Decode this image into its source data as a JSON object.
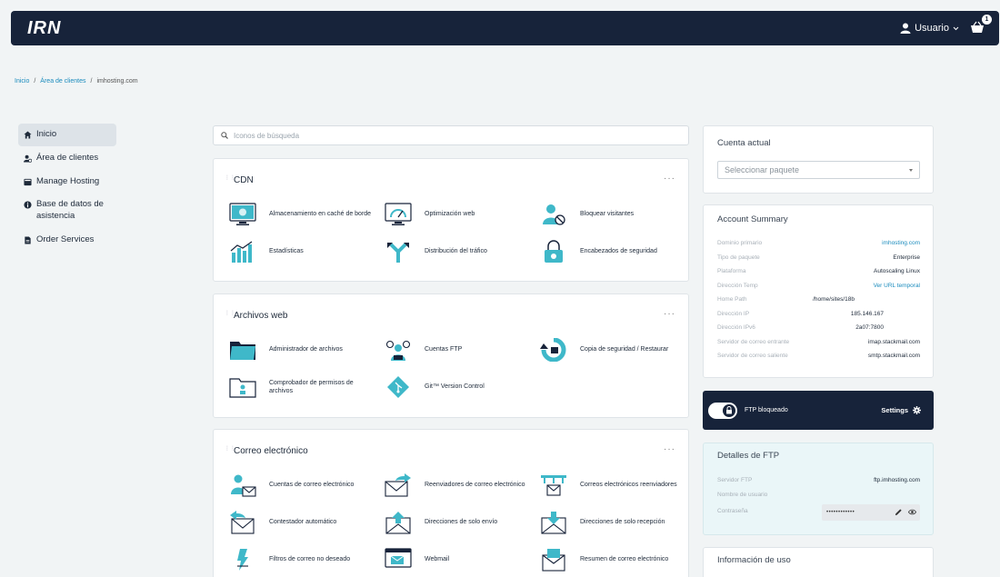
{
  "header": {
    "logo": "IRN",
    "user_label": "Usuario",
    "cart_count": "1"
  },
  "breadcrumb": {
    "home": "Inicio",
    "clients": "Área de clientes",
    "current": "imhosting.com"
  },
  "sidebar": {
    "items": [
      {
        "label": "Inicio",
        "icon": "home-icon"
      },
      {
        "label": "Área de clientes",
        "icon": "users-icon"
      },
      {
        "label": "Manage Hosting",
        "icon": "server-icon"
      },
      {
        "label": "Base de datos de asistencia",
        "icon": "info-icon"
      },
      {
        "label": "Order Services",
        "icon": "document-icon"
      }
    ]
  },
  "search": {
    "placeholder": "Iconos de búsqueda"
  },
  "panels": {
    "cdn": {
      "title": "CDN",
      "tiles": [
        {
          "label": "Almacenamiento en caché de borde",
          "icon": "monitor-icon"
        },
        {
          "label": "Optimización web",
          "icon": "speedometer-icon"
        },
        {
          "label": "Bloquear visitantes",
          "icon": "block-user-icon"
        },
        {
          "label": "Estadísticas",
          "icon": "bar-chart-icon"
        },
        {
          "label": "Distribución del tráfico",
          "icon": "traffic-split-icon"
        },
        {
          "label": "Encabezados de seguridad",
          "icon": "lock-icon"
        }
      ]
    },
    "files": {
      "title": "Archivos web",
      "tiles": [
        {
          "label": "Administrador de archivos",
          "icon": "folder-icon"
        },
        {
          "label": "Cuentas FTP",
          "icon": "ftp-users-icon"
        },
        {
          "label": "Copia de seguridad / Restaurar",
          "icon": "backup-icon"
        },
        {
          "label": "Comprobador de permisos de archivos",
          "icon": "folder-permission-icon"
        },
        {
          "label": "Git™ Version Control",
          "icon": "git-icon"
        }
      ]
    },
    "email": {
      "title": "Correo electrónico",
      "tiles": [
        {
          "label": "Cuentas de correo electrónico",
          "icon": "mail-user-icon"
        },
        {
          "label": "Reenviadores de correo electrónico",
          "icon": "mail-forward-icon"
        },
        {
          "label": "Correos electrónicos reenviadores",
          "icon": "mail-routing-icon"
        },
        {
          "label": "Contestador automático",
          "icon": "auto-reply-icon"
        },
        {
          "label": "Direcciones de solo envío",
          "icon": "mail-send-icon"
        },
        {
          "label": "Direcciones de solo recepción",
          "icon": "mail-receive-icon"
        },
        {
          "label": "Filtros de correo no deseado",
          "icon": "spam-filter-icon"
        },
        {
          "label": "Webmail",
          "icon": "webmail-icon"
        },
        {
          "label": "Resumen de correo electrónico",
          "icon": "mail-summary-icon"
        }
      ]
    }
  },
  "current_account": {
    "title": "Cuenta actual",
    "select_placeholder": "Seleccionar paquete"
  },
  "summary": {
    "title": "Account Summary",
    "rows": [
      {
        "key": "Dominio primario",
        "value": "imhosting.com"
      },
      {
        "key": "Tipo de paquete",
        "value": "Enterprise"
      },
      {
        "key": "Plataforma",
        "value": "Autoscaling Linux"
      },
      {
        "key": "Dirección Temp",
        "value": "Ver URL temporal"
      },
      {
        "key": "Home Path",
        "value": "/home/sites/18b"
      },
      {
        "key": "Dirección IP",
        "value": "185.146.167"
      },
      {
        "key": "Dirección IPv6",
        "value": "2a07:7800"
      },
      {
        "key": "Servidor de correo entrante",
        "value": "imap.stackmail.com"
      },
      {
        "key": "Servidor de correo saliente",
        "value": "smtp.stackmail.com"
      }
    ]
  },
  "ftp_lock": {
    "label": "FTP bloqueado",
    "settings": "Settings"
  },
  "ftp_details": {
    "title": "Detalles de FTP",
    "server_key": "Servidor FTP",
    "server_value": "ftp.imhosting.com",
    "user_key": "Nombre de usuario",
    "password_key": "Contraseña",
    "password_value": "••••••••••••"
  },
  "usage": {
    "title": "Información de uso"
  },
  "colors": {
    "navy": "#17233a",
    "accent": "#3fb8c9",
    "link": "#1a8bbd"
  }
}
